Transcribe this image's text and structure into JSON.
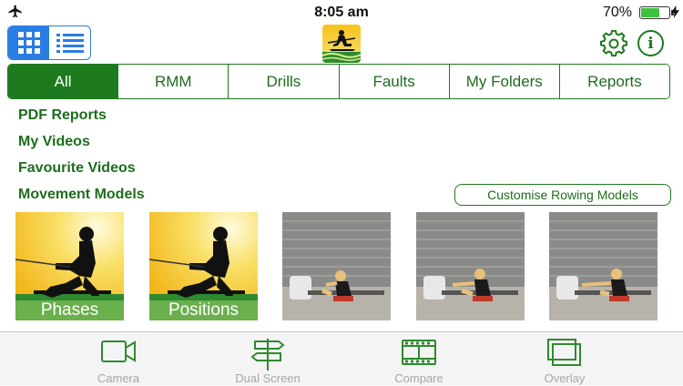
{
  "status_bar": {
    "time": "8:05 am",
    "battery_percent": "70%",
    "battery_level": 0.7,
    "icons": [
      "airplane-icon",
      "battery-icon",
      "charging-bolt-icon"
    ]
  },
  "header": {
    "view_modes": [
      "grid-view",
      "list-view"
    ],
    "active_view": "grid-view",
    "logo": "rowing-app-logo",
    "icons": [
      "gear-icon",
      "info-icon"
    ],
    "info_glyph": "i"
  },
  "tabs": [
    {
      "label": "All",
      "active": true
    },
    {
      "label": "RMM",
      "active": false
    },
    {
      "label": "Drills",
      "active": false
    },
    {
      "label": "Faults",
      "active": false
    },
    {
      "label": "My Folders",
      "active": false
    },
    {
      "label": "Reports",
      "active": false
    }
  ],
  "links": [
    "PDF Reports",
    "My Videos",
    "Favourite Videos",
    "Movement Models"
  ],
  "customise_button": "Customise Rowing Models",
  "thumbnails": [
    {
      "kind": "model",
      "caption": "Phases"
    },
    {
      "kind": "model",
      "caption": "Positions"
    },
    {
      "kind": "video",
      "caption": ""
    },
    {
      "kind": "video",
      "caption": ""
    },
    {
      "kind": "video",
      "caption": ""
    }
  ],
  "bottom_tabs": [
    {
      "label": "Camera",
      "icon": "camera-icon"
    },
    {
      "label": "Dual Screen",
      "icon": "signpost-icon"
    },
    {
      "label": "Compare",
      "icon": "film-strip-icon"
    },
    {
      "label": "Overlay",
      "icon": "overlay-icon"
    }
  ],
  "colors": {
    "brand_green": "#1e7a1e",
    "accent_blue": "#2a7de1",
    "caption_green": "#6ab04c",
    "tabbar_icon": "#2f8a2f",
    "tabbar_label": "#a7a7a7"
  }
}
